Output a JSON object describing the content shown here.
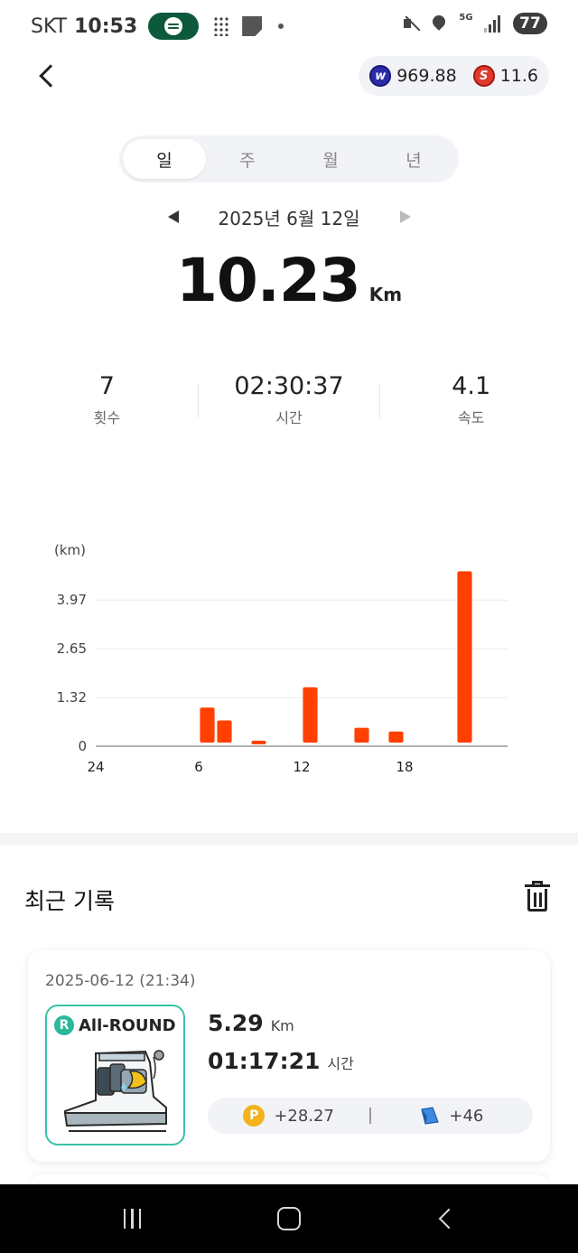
{
  "status_bar": {
    "carrier": "SKT",
    "time": "10:53",
    "battery": "77",
    "network": "5G"
  },
  "balances": {
    "w_coin": "969.88",
    "s_coin": "11.6"
  },
  "period_tabs": [
    {
      "label": "일",
      "active": true
    },
    {
      "label": "주",
      "active": false
    },
    {
      "label": "월",
      "active": false
    },
    {
      "label": "년",
      "active": false
    }
  ],
  "date_label": "2025년 6월 12일",
  "total": {
    "value": "10.23",
    "unit": "Km"
  },
  "stats": {
    "count": {
      "value": "7",
      "label": "횟수"
    },
    "time": {
      "value": "02:30:37",
      "label": "시간"
    },
    "speed": {
      "value": "4.1",
      "label": "속도"
    }
  },
  "chart_data": {
    "type": "bar",
    "ylabel": "(km)",
    "ylim": [
      0,
      5.3
    ],
    "y_ticks": [
      "3.97",
      "2.65",
      "1.32",
      "0"
    ],
    "x_ticks": [
      "24",
      "6",
      "12",
      "18"
    ],
    "x_tick_hours": [
      0,
      6,
      12,
      18
    ],
    "xlim": [
      0,
      24
    ],
    "bar_color": "#ff4000",
    "grid": true,
    "points": [
      {
        "hour": 6,
        "value": 1.05
      },
      {
        "hour": 7,
        "value": 0.7
      },
      {
        "hour": 9,
        "value": 0.15
      },
      {
        "hour": 12,
        "value": 1.6
      },
      {
        "hour": 15,
        "value": 0.5
      },
      {
        "hour": 17,
        "value": 0.4
      },
      {
        "hour": 21,
        "value": 4.75
      }
    ]
  },
  "recent": {
    "title": "최근 기록",
    "records": [
      {
        "date": "2025-06-12 (21:34)",
        "shoe_type": "All-ROUND",
        "distance": "5.29",
        "distance_unit": "Km",
        "duration": "01:17:21",
        "duration_unit": "시간",
        "reward_points": "+28.27",
        "reward_map": "+46"
      }
    ]
  },
  "colors": {
    "accent": "#ff4000",
    "shoe_border": "#38c2a6",
    "point_coin": "#f2b31b"
  }
}
